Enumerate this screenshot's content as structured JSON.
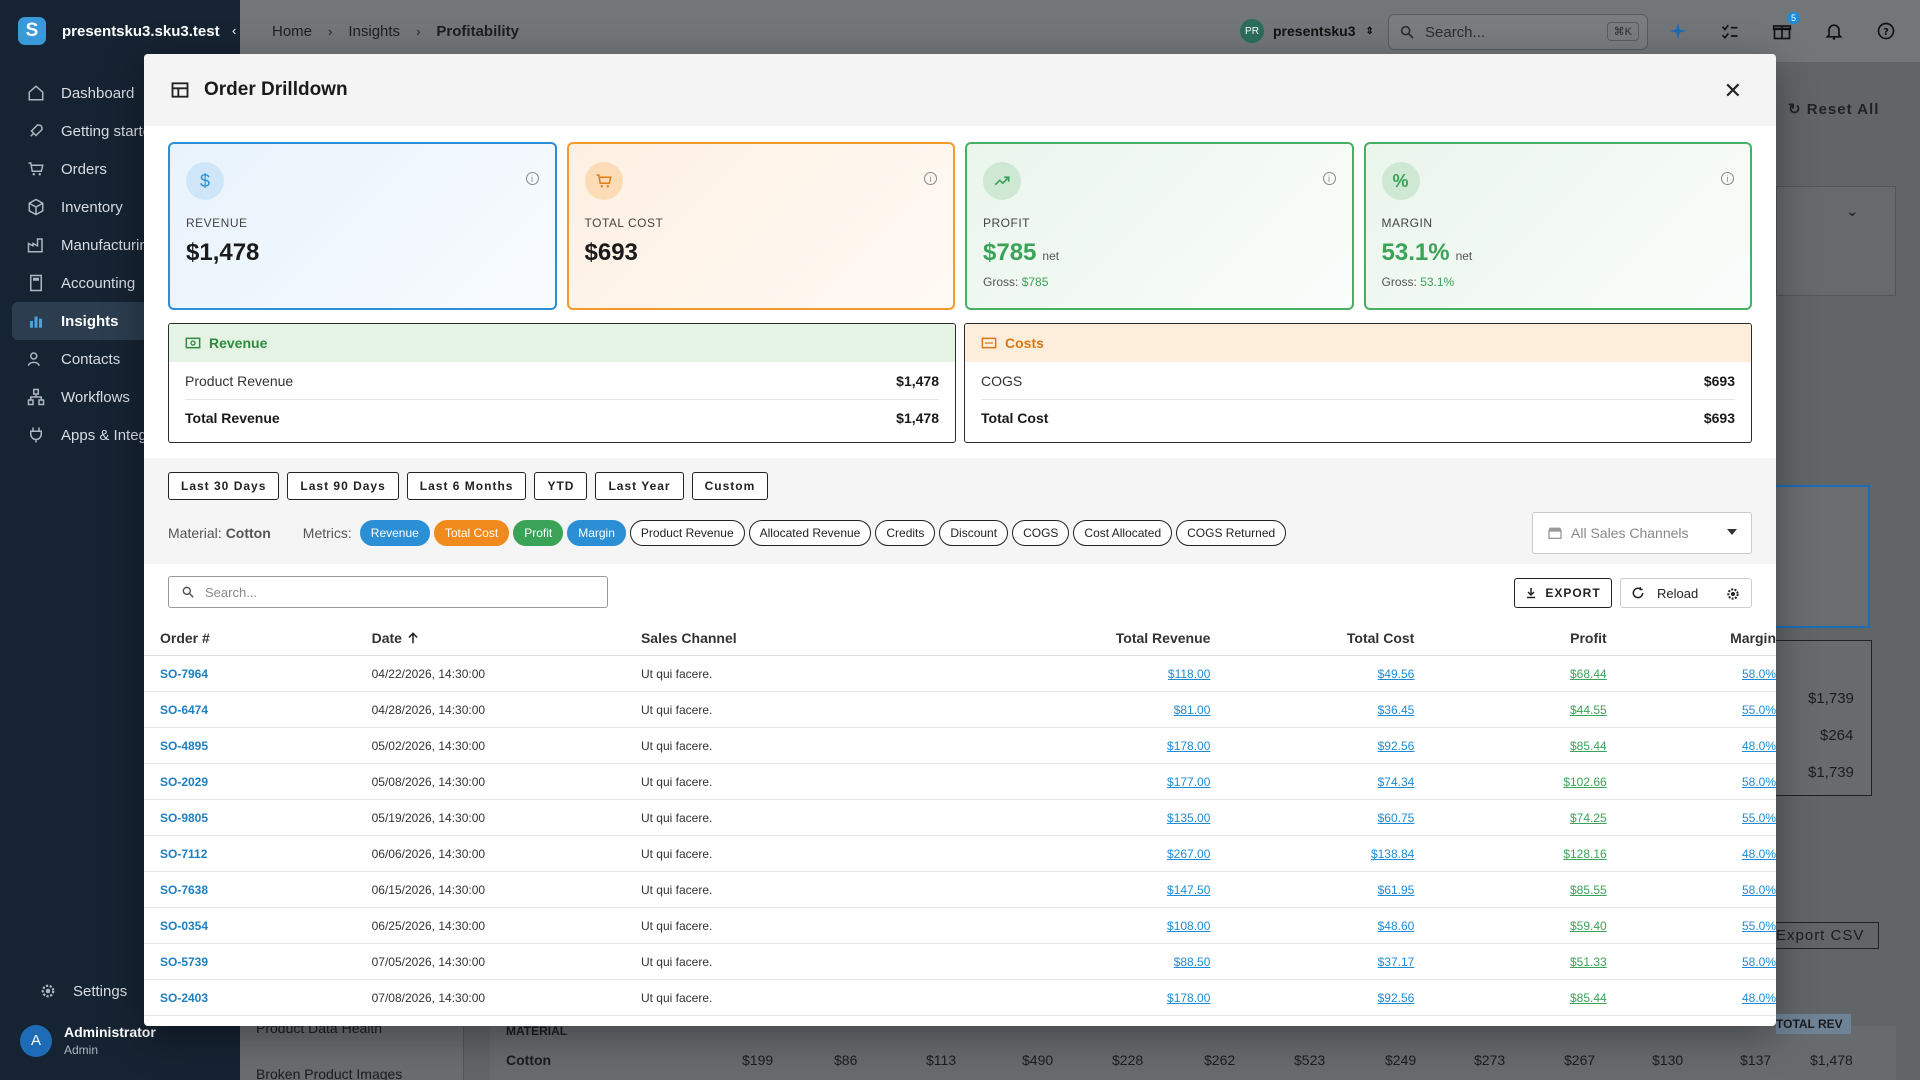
{
  "sidebar": {
    "org_name": "presentsku3.sku3.test",
    "items": [
      {
        "label": "Dashboard",
        "icon": "home-icon"
      },
      {
        "label": "Getting started",
        "icon": "rocket-icon"
      },
      {
        "label": "Orders",
        "icon": "cart-icon"
      },
      {
        "label": "Inventory",
        "icon": "box-icon"
      },
      {
        "label": "Manufacturing",
        "icon": "factory-icon"
      },
      {
        "label": "Accounting",
        "icon": "calculator-icon"
      },
      {
        "label": "Insights",
        "icon": "chart-icon",
        "active": true
      },
      {
        "label": "Contacts",
        "icon": "people-icon"
      },
      {
        "label": "Workflows",
        "icon": "workflow-icon"
      },
      {
        "label": "Apps & Integrations",
        "icon": "plug-icon"
      }
    ],
    "settings_label": "Settings",
    "user": {
      "initial": "A",
      "name": "Administrator",
      "role": "Admin"
    }
  },
  "topbar": {
    "breadcrumbs": [
      "Home",
      "Insights",
      "Profitability"
    ],
    "user": {
      "initials": "PR",
      "name": "presentsku3"
    },
    "search_placeholder": "Search...",
    "shortcut": "⌘K",
    "gift_badge": "5"
  },
  "background": {
    "reset_all": "Reset All",
    "values": [
      "$1,739",
      "$264",
      "$1,739"
    ],
    "export_csv": "Export CSV",
    "side_links": [
      "Product Data Health",
      "Broken Product Images"
    ],
    "table_header": [
      "MATERIAL",
      "TOTAL REV"
    ],
    "row_label": "Cotton",
    "row_values": [
      "$199",
      "$86",
      "$113",
      "$490",
      "$228",
      "$262",
      "$523",
      "$249",
      "$273",
      "$267",
      "$130",
      "$137",
      "$1,478"
    ]
  },
  "modal": {
    "title": "Order Drilldown",
    "cards": {
      "revenue": {
        "label": "REVENUE",
        "value": "$1,478",
        "color": "#2b8fd6"
      },
      "total_cost": {
        "label": "TOTAL COST",
        "value": "$693",
        "color": "#f39a2d"
      },
      "profit": {
        "label": "PROFIT",
        "value": "$785",
        "suffix": "net",
        "gross_label": "Gross:",
        "gross_value": "$785",
        "color": "#48b063"
      },
      "margin": {
        "label": "MARGIN",
        "value": "53.1%",
        "suffix": "net",
        "gross_label": "Gross:",
        "gross_value": "53.1%",
        "color": "#48b063"
      }
    },
    "revenue_panel": {
      "title": "Revenue",
      "rows": [
        {
          "label": "Product Revenue",
          "value": "$1,478"
        },
        {
          "label": "Total Revenue",
          "value": "$1,478"
        }
      ]
    },
    "costs_panel": {
      "title": "Costs",
      "rows": [
        {
          "label": "COGS",
          "value": "$693"
        },
        {
          "label": "Total Cost",
          "value": "$693"
        }
      ]
    },
    "ranges": [
      "Last 30 Days",
      "Last 90 Days",
      "Last 6 Months",
      "YTD",
      "Last Year",
      "Custom"
    ],
    "material_label": "Material:",
    "material_value": "Cotton",
    "metrics_label": "Metrics:",
    "metrics": [
      "Revenue",
      "Total Cost",
      "Profit",
      "Margin",
      "Product Revenue",
      "Allocated Revenue",
      "Credits",
      "Discount",
      "COGS",
      "Cost Allocated",
      "COGS Returned"
    ],
    "channel_select": "All Sales Channels",
    "search_placeholder": "Search...",
    "export_label": "EXPORT",
    "reload_label": "Reload",
    "table": {
      "columns": [
        "Order #",
        "Date",
        "Sales Channel",
        "Total Revenue",
        "Total Cost",
        "Profit",
        "Margin"
      ],
      "rows": [
        [
          "SO-7964",
          "04/22/2026, 14:30:00",
          "Ut qui facere.",
          "$118.00",
          "$49.56",
          "$68.44",
          "58.0%"
        ],
        [
          "SO-6474",
          "04/28/2026, 14:30:00",
          "Ut qui facere.",
          "$81.00",
          "$36.45",
          "$44.55",
          "55.0%"
        ],
        [
          "SO-4895",
          "05/02/2026, 14:30:00",
          "Ut qui facere.",
          "$178.00",
          "$92.56",
          "$85.44",
          "48.0%"
        ],
        [
          "SO-2029",
          "05/08/2026, 14:30:00",
          "Ut qui facere.",
          "$177.00",
          "$74.34",
          "$102.66",
          "58.0%"
        ],
        [
          "SO-9805",
          "05/19/2026, 14:30:00",
          "Ut qui facere.",
          "$135.00",
          "$60.75",
          "$74.25",
          "55.0%"
        ],
        [
          "SO-7112",
          "06/06/2026, 14:30:00",
          "Ut qui facere.",
          "$267.00",
          "$138.84",
          "$128.16",
          "48.0%"
        ],
        [
          "SO-7638",
          "06/15/2026, 14:30:00",
          "Ut qui facere.",
          "$147.50",
          "$61.95",
          "$85.55",
          "58.0%"
        ],
        [
          "SO-0354",
          "06/25/2026, 14:30:00",
          "Ut qui facere.",
          "$108.00",
          "$48.60",
          "$59.40",
          "55.0%"
        ],
        [
          "SO-5739",
          "07/05/2026, 14:30:00",
          "Ut qui facere.",
          "$88.50",
          "$37.17",
          "$51.33",
          "58.0%"
        ],
        [
          "SO-2403",
          "07/08/2026, 14:30:00",
          "Ut qui facere.",
          "$178.00",
          "$92.56",
          "$85.44",
          "48.0%"
        ]
      ]
    }
  }
}
